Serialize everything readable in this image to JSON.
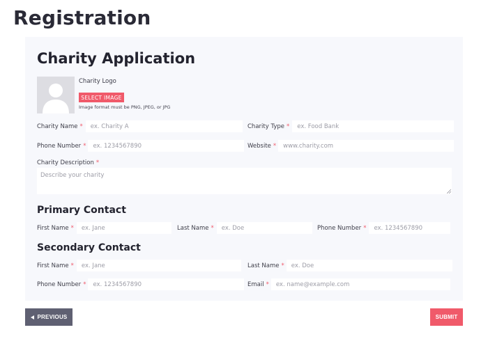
{
  "page": {
    "title": "Registration"
  },
  "form": {
    "title": "Charity Application",
    "logo": {
      "label": "Charity Logo",
      "button_label": "SELECT IMAGE",
      "format_note": "Image format must be PNG, JPEG, or JPG"
    },
    "required_marker": "*",
    "charity_name": {
      "label": "Charity Name",
      "placeholder": "ex. Charity A"
    },
    "charity_type": {
      "label": "Charity Type",
      "placeholder": "ex. Food Bank"
    },
    "phone_number": {
      "label": "Phone Number",
      "placeholder": "ex. 1234567890"
    },
    "website": {
      "label": "Website",
      "placeholder": "www.charity.com"
    },
    "description": {
      "label": "Charity Description",
      "placeholder": "Describe your charity"
    }
  },
  "primary_contact": {
    "title": "Primary Contact",
    "first_name": {
      "label": "First Name",
      "placeholder": "ex. Jane"
    },
    "last_name": {
      "label": "Last Name",
      "placeholder": "ex. Doe"
    },
    "phone_number": {
      "label": "Phone Number",
      "placeholder": "ex. 1234567890"
    }
  },
  "secondary_contact": {
    "title": "Secondary Contact",
    "first_name": {
      "label": "First Name",
      "placeholder": "ex. Jane"
    },
    "last_name": {
      "label": "Last Name",
      "placeholder": "ex. Doe"
    },
    "phone_number": {
      "label": "Phone Number",
      "placeholder": "ex. 1234567890"
    },
    "email": {
      "label": "Email",
      "placeholder": "ex. name@example.com"
    }
  },
  "navigation": {
    "previous_label": "PREVIOUS",
    "submit_label": "SUBMIT"
  },
  "colors": {
    "accent": "#f05a6a",
    "card_background": "#f7f8fc",
    "previous_button": "#5f6072"
  },
  "icons": {
    "logo_placeholder": "user-silhouette-icon",
    "previous": "triangle-left-icon",
    "resize": "resize-handle-icon"
  }
}
